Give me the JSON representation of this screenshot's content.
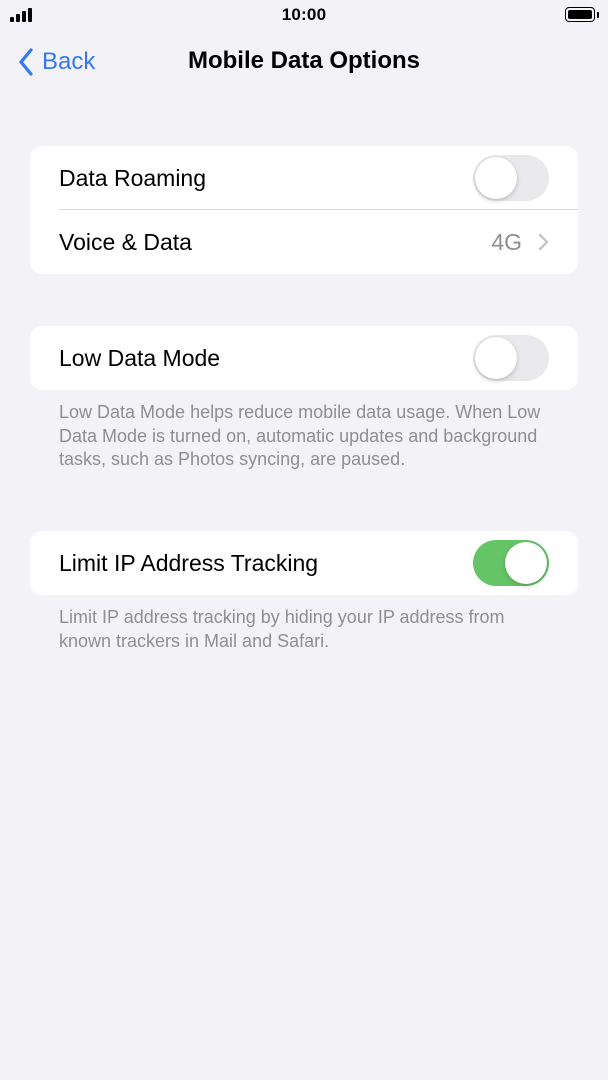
{
  "status_bar": {
    "time": "10:00"
  },
  "nav": {
    "back_label": "Back",
    "title": "Mobile Data Options"
  },
  "settings": {
    "data_roaming": {
      "label": "Data Roaming",
      "enabled": false
    },
    "voice_data": {
      "label": "Voice & Data",
      "value": "4G"
    },
    "low_data_mode": {
      "label": "Low Data Mode",
      "enabled": false,
      "footer": "Low Data Mode helps reduce mobile data usage. When Low Data Mode is turned on, automatic updates and background tasks, such as Photos syncing, are paused."
    },
    "limit_ip_tracking": {
      "label": "Limit IP Address Tracking",
      "enabled": true,
      "footer": "Limit IP address tracking by hiding your IP address from known trackers in Mail and Safari."
    }
  },
  "colors": {
    "accent": "#3478f6",
    "toggle_on": "#65c466",
    "toggle_off": "#e9e9eb",
    "background": "#f2f2f7",
    "secondary_text": "#8e8e93"
  },
  "icons": [
    "signal-icon",
    "battery-icon",
    "back-chevron-icon",
    "chevron-right-icon"
  ]
}
